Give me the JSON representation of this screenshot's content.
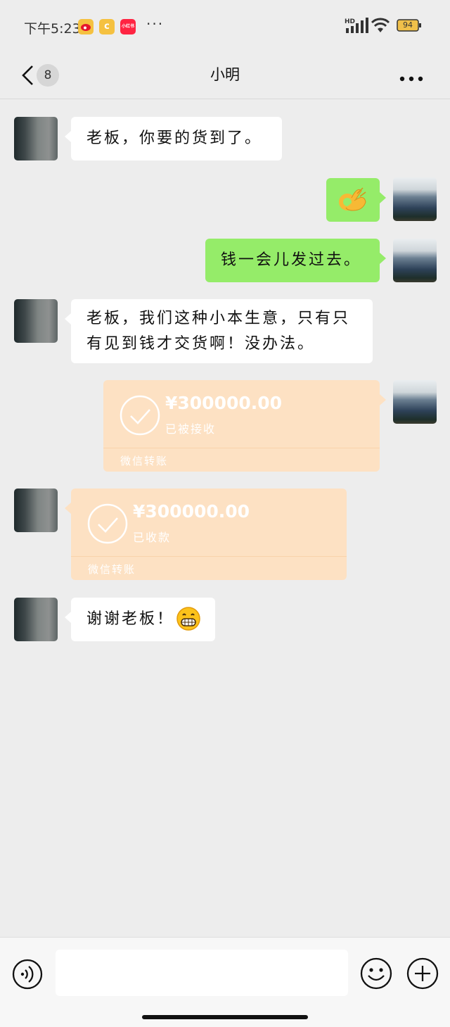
{
  "status_bar": {
    "time": "下午5:23",
    "app_icon_weibo": "weibo-icon",
    "app_icon_c": "c",
    "app_icon_red": "小红书",
    "more_dots": "···",
    "battery": "94"
  },
  "header": {
    "back_badge": "8",
    "title": "小明"
  },
  "messages": [
    {
      "from": "them",
      "text": "老板，你要的货到了。"
    },
    {
      "from": "me",
      "emoji": "ok-hand-emoji"
    },
    {
      "from": "me",
      "text": "钱一会儿发过去。"
    },
    {
      "from": "them",
      "text": "老板，我们这种小本生意，只有只有见到钱才交货啊！没办法。"
    },
    {
      "from": "me",
      "type": "transfer",
      "amount": "¥300000.00",
      "status": "已被接收",
      "label": "微信转账"
    },
    {
      "from": "them",
      "type": "transfer",
      "amount": "¥300000.00",
      "status": "已收款",
      "label": "微信转账"
    },
    {
      "from": "them",
      "text": "谢谢老板！",
      "emoji": "grin-emoji"
    }
  ],
  "input_bar": {
    "placeholder": ""
  },
  "colors": {
    "background": "#ededed",
    "bubble_white": "#ffffff",
    "bubble_green": "#95ec69",
    "transfer": "#fde1c3"
  }
}
